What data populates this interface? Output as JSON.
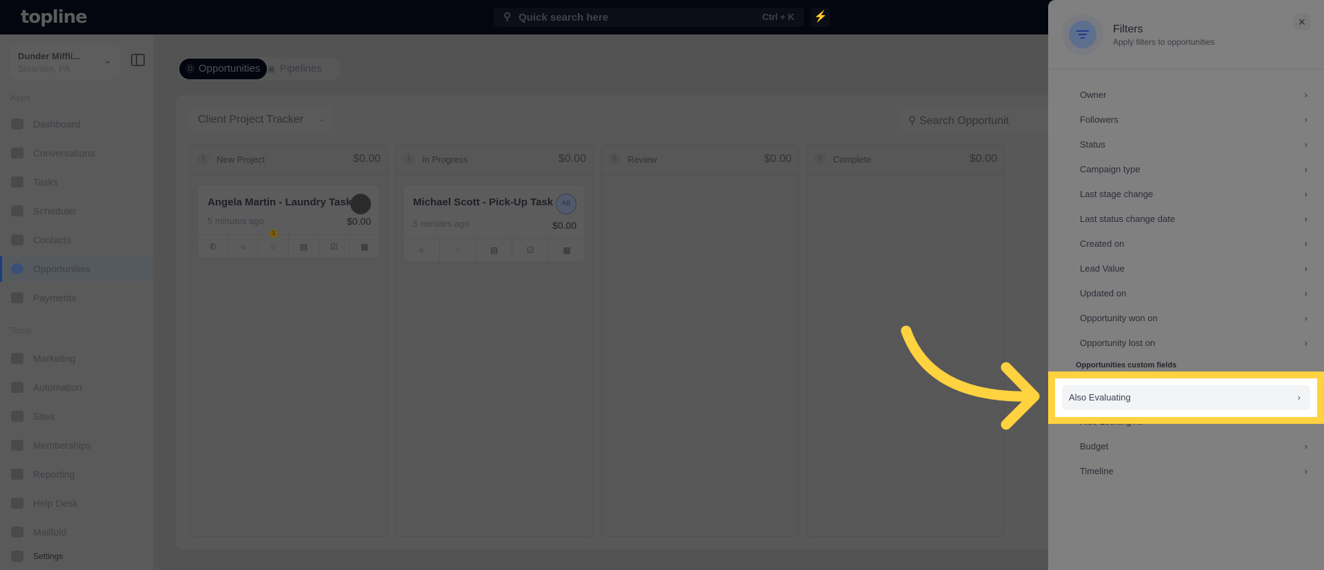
{
  "topbar": {
    "logo": "topline",
    "search_placeholder": "Quick search here",
    "shortcut": "Ctrl + K",
    "search_icon": "search-icon",
    "bolt_icon": "lightning-icon"
  },
  "sidebar": {
    "account_name": "Dunder Miffli...",
    "account_location": "Scranton, PA",
    "apps_label": "Apps",
    "tools_label": "Tools",
    "apps": [
      {
        "label": "Dashboard"
      },
      {
        "label": "Conversations"
      },
      {
        "label": "Tasks"
      },
      {
        "label": "Scheduler"
      },
      {
        "label": "Contacts"
      },
      {
        "label": "Opportunities",
        "active": true
      },
      {
        "label": "Payments"
      }
    ],
    "tools": [
      {
        "label": "Marketing"
      },
      {
        "label": "Automation"
      },
      {
        "label": "Sites"
      },
      {
        "label": "Memberships"
      },
      {
        "label": "Reporting"
      },
      {
        "label": "Help Desk"
      },
      {
        "label": "Mailfold"
      }
    ],
    "settings": "Settings"
  },
  "main": {
    "tabs": [
      {
        "label": "Opportunities",
        "active": true
      },
      {
        "label": "Pipelines"
      }
    ],
    "pipeline": "Client Project Tracker",
    "search_placeholder": "Search Opportunit",
    "columns": [
      {
        "name": "New Project",
        "count": "1",
        "amount": "$0.00",
        "cards": [
          {
            "title": "Angela Martin - Laundry Task",
            "time": "5 minutes ago",
            "value": "$0.00",
            "avatar": "photo",
            "tag_badge": "3",
            "actions": [
              "phone",
              "chat",
              "tag",
              "document",
              "check",
              "calendar"
            ]
          }
        ]
      },
      {
        "name": "In Progress",
        "count": "1",
        "amount": "$0.00",
        "cards": [
          {
            "title": "Michael Scott - Pick-Up Task",
            "time": "5 minutes ago",
            "value": "$0.00",
            "avatar": "AB",
            "actions": [
              "chat",
              "tag",
              "document",
              "check",
              "calendar"
            ]
          }
        ]
      },
      {
        "name": "Review",
        "count": "0",
        "amount": "$0.00",
        "cards": []
      },
      {
        "name": "Complete",
        "count": "0",
        "amount": "$0.00",
        "cards": []
      }
    ]
  },
  "filters": {
    "title": "Filters",
    "subtitle": "Apply filters to opportunities",
    "close": "×",
    "items": [
      "Owner",
      "Followers",
      "Status",
      "Campaign type",
      "Last stage change",
      "Last status change date",
      "Created on",
      "Lead Value",
      "Updated on",
      "Opportunity won on",
      "Opportunity lost on"
    ],
    "custom_header": "Opportunities custom fields",
    "custom_items": [
      "Also Evaluating",
      "Also Looking At",
      "Budget",
      "Timeline"
    ],
    "highlighted": "Also Evaluating"
  },
  "colors": {
    "highlight": "#ffd23f",
    "topbar": "#03060f",
    "accent": "#1e3a8a"
  }
}
